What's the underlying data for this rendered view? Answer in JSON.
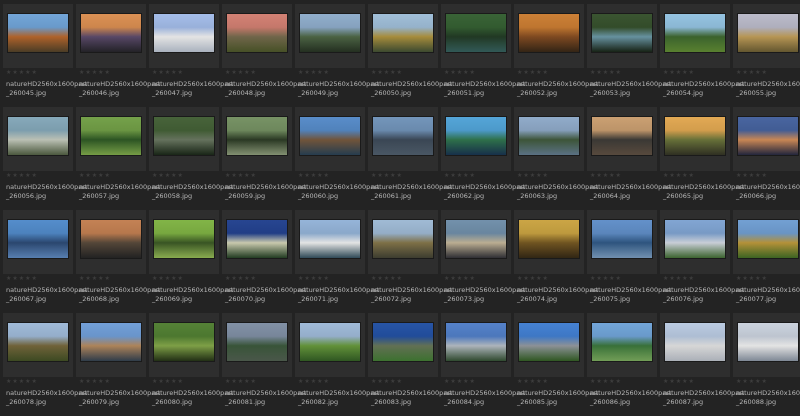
{
  "browser": {
    "rating_stars": "★★★★★",
    "items": [
      {
        "line1": "natureHD2560x1600part",
        "line2": "_260045.jpg",
        "colors": [
          "#6aa0d6",
          "#c26a2a",
          "#5c4a2e"
        ]
      },
      {
        "line1": "natureHD2560x1600part",
        "line2": "_260046.jpg",
        "colors": [
          "#d98a4a",
          "#5e4b6f",
          "#2b2a30"
        ]
      },
      {
        "line1": "natureHD2560x1600part",
        "line2": "_260047.jpg",
        "colors": [
          "#9fb9e8",
          "#ffffff",
          "#cfd9e8"
        ]
      },
      {
        "line1": "natureHD2560x1600part",
        "line2": "_260048.jpg",
        "colors": [
          "#d07a6c",
          "#7a6e4e",
          "#56622f"
        ]
      },
      {
        "line1": "natureHD2560x1600part",
        "line2": "_260049.jpg",
        "colors": [
          "#8aa9c9",
          "#4f6a46",
          "#2c3a28"
        ]
      },
      {
        "line1": "natureHD2560x1600part",
        "line2": "_260050.jpg",
        "colors": [
          "#9bbbd6",
          "#b89a3e",
          "#4a5a3a"
        ]
      },
      {
        "line1": "natureHD2560x1600part",
        "line2": "_260051.jpg",
        "colors": [
          "#2d5a2a",
          "#1f3a22",
          "#3d6d6a"
        ]
      },
      {
        "line1": "natureHD2560x1600part",
        "line2": "_260052.jpg",
        "colors": [
          "#c9782a",
          "#8a4d1f",
          "#3f2d1a"
        ]
      },
      {
        "line1": "natureHD2560x1600part",
        "line2": "_260053.jpg",
        "colors": [
          "#2e4a24",
          "#6fa0b0",
          "#1c2a1a"
        ]
      },
      {
        "line1": "natureHD2560x1600part",
        "line2": "_260054.jpg",
        "colors": [
          "#8fc0e0",
          "#3d6a2c",
          "#6c9c3a"
        ]
      },
      {
        "line1": "natureHD2560x1600part",
        "line2": "_260055.jpg",
        "colors": [
          "#b7b7c7",
          "#cba55a",
          "#7a6a3a"
        ]
      },
      {
        "line1": "natureHD2560x1600part",
        "line2": "_260056.jpg",
        "colors": [
          "#7fa4b6",
          "#d0d6c8",
          "#5c6c4c"
        ]
      },
      {
        "line1": "natureHD2560x1600part",
        "line2": "_260057.jpg",
        "colors": [
          "#6c9b3f",
          "#2c5a22",
          "#8fbf55"
        ]
      },
      {
        "line1": "natureHD2560x1600part",
        "line2": "_260058.jpg",
        "colors": [
          "#3c5a2e",
          "#6d7c64",
          "#1f2e1c"
        ]
      },
      {
        "line1": "natureHD2560x1600part",
        "line2": "_260059.jpg",
        "colors": [
          "#6f8c5c",
          "#2a3a22",
          "#9fb08a"
        ]
      },
      {
        "line1": "natureHD2560x1600part",
        "line2": "_260060.jpg",
        "colors": [
          "#4f86c6",
          "#7b5a3c",
          "#2e4a60"
        ]
      },
      {
        "line1": "natureHD2560x1600part",
        "line2": "_260061.jpg",
        "colors": [
          "#6b8fb6",
          "#3c4a5a",
          "#5a6a7a"
        ]
      },
      {
        "line1": "natureHD2560x1600part",
        "line2": "_260062.jpg",
        "colors": [
          "#4aa0d6",
          "#2e7a4e",
          "#1c3a5a"
        ]
      },
      {
        "line1": "natureHD2560x1600part",
        "line2": "_260063.jpg",
        "colors": [
          "#8aa6c6",
          "#3f5a3a",
          "#6e8aa0"
        ]
      },
      {
        "line1": "natureHD2560x1600part",
        "line2": "_260064.jpg",
        "colors": [
          "#c79a6a",
          "#3c3a36",
          "#6b5a4a"
        ]
      },
      {
        "line1": "natureHD2560x1600part",
        "line2": "_260065.jpg",
        "colors": [
          "#e0a44a",
          "#6f7a3a",
          "#3a3a2a"
        ]
      },
      {
        "line1": "natureHD2560x1600part",
        "line2": "_260066.jpg",
        "colors": [
          "#3e5c9a",
          "#e0945a",
          "#2a2e4a"
        ]
      },
      {
        "line1": "natureHD2560x1600part",
        "line2": "_260067.jpg",
        "colors": [
          "#4a86c8",
          "#2a4a78",
          "#6a9ad6"
        ]
      },
      {
        "line1": "natureHD2560x1600part",
        "line2": "_260068.jpg",
        "colors": [
          "#c07a4a",
          "#5a4a3a",
          "#2a2a2a"
        ]
      },
      {
        "line1": "natureHD2560x1600part",
        "line2": "_260069.jpg",
        "colors": [
          "#7ab03c",
          "#3a5a22",
          "#a6d060"
        ]
      },
      {
        "line1": "natureHD2560x1600part",
        "line2": "_260070.jpg",
        "colors": [
          "#1a3a8a",
          "#e0e0c0",
          "#2a4a2a"
        ]
      },
      {
        "line1": "natureHD2560x1600part",
        "line2": "_260071.jpg",
        "colors": [
          "#8fb0d6",
          "#ffffff",
          "#3a5a6a"
        ]
      },
      {
        "line1": "natureHD2560x1600part",
        "line2": "_260072.jpg",
        "colors": [
          "#9ab6d2",
          "#8a7a4a",
          "#4a4a3a"
        ]
      },
      {
        "line1": "natureHD2560x1600part",
        "line2": "_260073.jpg",
        "colors": [
          "#6a8aa6",
          "#d0c0a0",
          "#3a3a40"
        ]
      },
      {
        "line1": "natureHD2560x1600part",
        "line2": "_260074.jpg",
        "colors": [
          "#c8a03a",
          "#7a5a1f",
          "#3c2e18"
        ]
      },
      {
        "line1": "natureHD2560x1600part",
        "line2": "_260075.jpg",
        "colors": [
          "#5a8ac6",
          "#2e5a8a",
          "#8ab0d6"
        ]
      },
      {
        "line1": "natureHD2560x1600part",
        "line2": "_260076.jpg",
        "colors": [
          "#7aa0d0",
          "#e0e6f0",
          "#4a7a3a"
        ]
      },
      {
        "line1": "natureHD2560x1600part",
        "line2": "_260077.jpg",
        "colors": [
          "#6a9ad0",
          "#c8a03a",
          "#4a7a2a"
        ]
      },
      {
        "line1": "natureHD2560x1600part",
        "line2": "_260078.jpg",
        "colors": [
          "#9ab6d6",
          "#7a6a3a",
          "#4a5a2a"
        ]
      },
      {
        "line1": "natureHD2560x1600part",
        "line2": "_260079.jpg",
        "colors": [
          "#6a9ad6",
          "#c09060",
          "#3a4a5a"
        ]
      },
      {
        "line1": "natureHD2560x1600part",
        "line2": "_260080.jpg",
        "colors": [
          "#4a7a2a",
          "#8ab04a",
          "#2a3a1a"
        ]
      },
      {
        "line1": "natureHD2560x1600part",
        "line2": "_260081.jpg",
        "colors": [
          "#7a8aa0",
          "#3a5a3a",
          "#5a6a5a"
        ]
      },
      {
        "line1": "natureHD2560x1600part",
        "line2": "_260082.jpg",
        "colors": [
          "#9ab6d6",
          "#6aa03a",
          "#3a6a2a"
        ]
      },
      {
        "line1": "natureHD2560x1600part",
        "line2": "_260083.jpg",
        "colors": [
          "#1a4aa0",
          "#6a7a5a",
          "#4a8a3a"
        ]
      },
      {
        "line1": "natureHD2560x1600part",
        "line2": "_260084.jpg",
        "colors": [
          "#4a7ac6",
          "#c0c8d0",
          "#3a5a3a"
        ]
      },
      {
        "line1": "natureHD2560x1600part",
        "line2": "_260085.jpg",
        "colors": [
          "#3a7ad0",
          "#9aa0a6",
          "#3a6a2a"
        ]
      },
      {
        "line1": "natureHD2560x1600part",
        "line2": "_260086.jpg",
        "colors": [
          "#6aa0d6",
          "#3a7a3a",
          "#8ac06a"
        ]
      },
      {
        "line1": "natureHD2560x1600part",
        "line2": "_260087.jpg",
        "colors": [
          "#b6c8e0",
          "#f0f0f0",
          "#d0d6e0"
        ]
      },
      {
        "line1": "natureHD2560x1600part",
        "line2": "_260088.jpg",
        "colors": [
          "#c8d0dc",
          "#ffffff",
          "#9aa6b6"
        ]
      }
    ]
  }
}
